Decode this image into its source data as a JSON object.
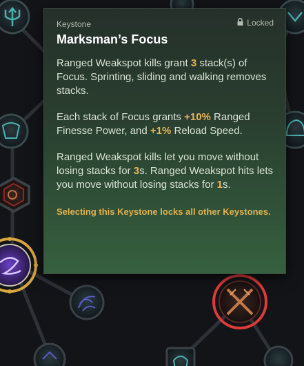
{
  "tooltip": {
    "category": "Keystone",
    "status": "Locked",
    "title": "Marksman’s Focus",
    "p1": {
      "a": "Ranged Weakspot kills grant ",
      "n1": "3",
      "b": " stack(s) of Focus. Sprinting, sliding and walking removes stacks."
    },
    "p2": {
      "a": "Each stack of Focus grants ",
      "n1": "+10%",
      "b": " Ranged Finesse Power, and ",
      "n2": "+1%",
      "c": " Reload Speed."
    },
    "p3": {
      "a": "Ranged Weakspot kills let you move without losing stacks for ",
      "n1": "3",
      "b": "s. Ranged Weakspot hits lets you move without losing stacks for ",
      "n2": "1",
      "c": "s."
    },
    "warning": "Selecting this Keystone locks all other Keystones."
  },
  "icons": {
    "lock": "lock-icon",
    "nodes": [
      "trident-node-icon",
      "chest-node-icon",
      "skull-node-icon",
      "helmet-node-icon",
      "claw-node-icon",
      "warp-node-icon",
      "crossed-blades-node-icon",
      "soldier-node-icon",
      "bottom-node-icon"
    ]
  },
  "colors": {
    "tooltip_top": "#25302a",
    "tooltip_bottom": "#36603f",
    "highlight": "#e8b558",
    "selected_ring": "#e03a3a",
    "active_ring": "#d9a640",
    "warp": "#9a6ee8"
  }
}
